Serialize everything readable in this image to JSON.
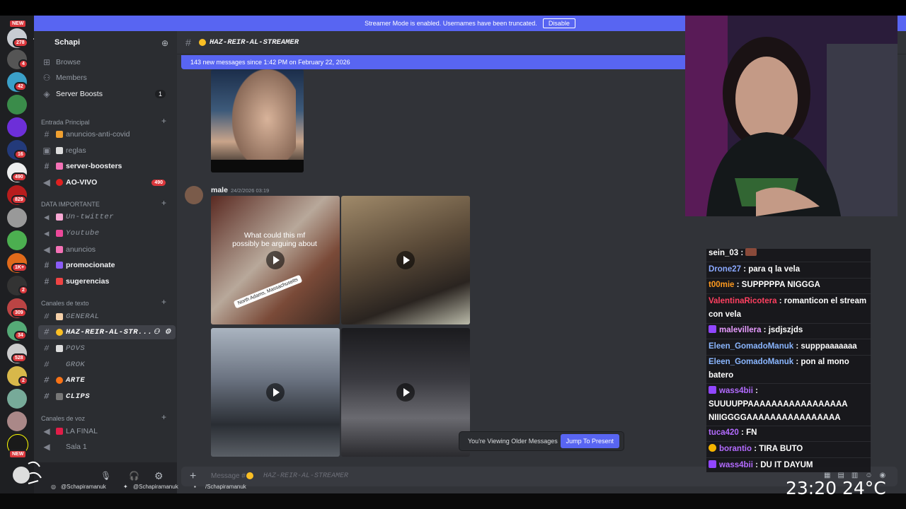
{
  "banner": {
    "text": "Streamer Mode is enabled. Usernames have been truncated.",
    "button": "Disable",
    "close": "×"
  },
  "rail": {
    "new_top": "NEW",
    "new_bottom": "NEW",
    "badges": [
      "278",
      "4",
      "42",
      "16",
      "490",
      "829",
      "1K+",
      "2",
      "309",
      "34",
      "528",
      "2"
    ]
  },
  "server": {
    "name": "Schapi",
    "browse": "Browse",
    "members": "Members",
    "boosts": "Server Boosts",
    "boosts_count": "1"
  },
  "categories": {
    "entrada": "Entrada Principal",
    "data": "DATA IMPORTANTE",
    "texto": "Canales de texto",
    "voz": "Canales de voz"
  },
  "channels": {
    "anuncios_covid": "anuncios-anti-covid",
    "reglas": "reglas",
    "boosters": "server-boosters",
    "aovivo": "AO-VIVO",
    "aovivo_badge": "490",
    "untwitter": "Un-twitter",
    "youtube": "Youtube",
    "anuncios": "anuncios",
    "promocionate": "promocionate",
    "sugerencias": "sugerencias",
    "general": "GENERAL",
    "hazreir": "HAZ-REIR-AL-STR...",
    "povs": "POVS",
    "grok": "GROK",
    "arte": "ARTE",
    "clips": "CLIPS",
    "lafinal": "LA FINAL",
    "sala1": "Sala 1"
  },
  "chat": {
    "channel_title": "HAZ-REIR-AL-STREAMER",
    "new_messages": "143 new messages since 1:42 PM on February 22, 2026",
    "author": "male",
    "timestamp": "24/2/2026 03:19",
    "video_caption": "What could this mf possibly be arguing about",
    "video_location": "North Adams, Massachusetts",
    "older_text": "You're Viewing Older Messages",
    "jump": "Jump To Present",
    "placeholder": "Message #",
    "placeholder_channel": "HAZ-REIR-AL-STREAMER"
  },
  "twitch_chat": [
    {
      "user": "sein_03",
      "msg": "",
      "color": "#ffffff"
    },
    {
      "user": "Drone27",
      "msg": "para q la vela",
      "color": "#8aa8ff"
    },
    {
      "user": "t00mie",
      "msg": "SUPPPPPA NIGGGA",
      "color": "#ff9a1f"
    },
    {
      "user": "ValentinaRicotera",
      "msg": "romanticon el stream con vela",
      "color": "#ff4060"
    },
    {
      "user": "malevillera",
      "msg": "jsdjszjds",
      "color": "#e79bff"
    },
    {
      "user": "Eleen_GomadoManuk",
      "msg": "supppaaaaaaa",
      "color": "#8ab6ff"
    },
    {
      "user": "Eleen_GomadoManuk",
      "msg": "pon al mono batero",
      "color": "#8ab6ff"
    },
    {
      "user": "wass4bii",
      "msg": "SUUUUPPAAAAAAAAAAAAAAAAA NIIIGGGGAAAAAAAAAAAAAAAA",
      "color": "#b36bff"
    },
    {
      "user": "tuca420",
      "msg": "FN",
      "color": "#b36bff"
    },
    {
      "user": "borantio",
      "msg": "TIRA BUTO",
      "color": "#b36bff"
    },
    {
      "user": "wass4bii",
      "msg": "DU IT DAYUM",
      "color": "#b36bff"
    }
  ],
  "overlay": {
    "time": "23:20",
    "temp": "24°C",
    "ig": "@Schapiramanuk",
    "tw": "@Schapiramanuk",
    "fb": "/Schapiramanuk"
  },
  "colors": {
    "blurple": "#5865f2",
    "red": "#da373c",
    "bg": "#313338"
  }
}
